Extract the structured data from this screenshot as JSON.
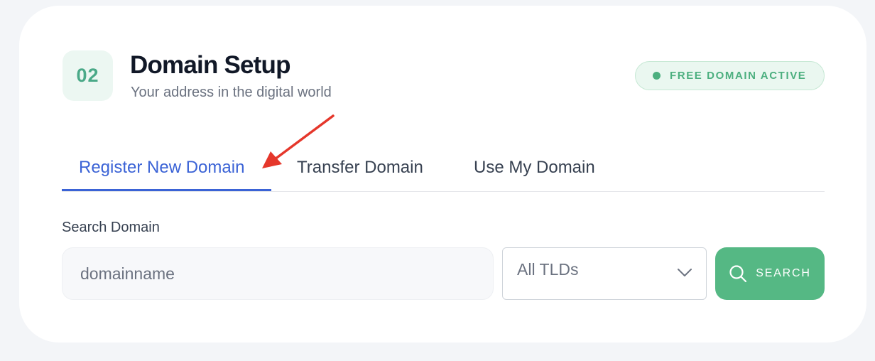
{
  "step": {
    "number": "02"
  },
  "header": {
    "title": "Domain Setup",
    "subtitle": "Your address in the digital world",
    "status_badge": "FREE DOMAIN ACTIVE"
  },
  "tabs": [
    {
      "label": "Register New Domain",
      "active": true
    },
    {
      "label": "Transfer Domain",
      "active": false
    },
    {
      "label": "Use My Domain",
      "active": false
    }
  ],
  "search": {
    "label": "Search Domain",
    "placeholder": "domainname",
    "value": "",
    "tld_selected": "All TLDs",
    "button_label": "SEARCH"
  },
  "annotation": {
    "arrow_color": "#e5372b"
  },
  "colors": {
    "accent_blue": "#3b63d6",
    "brand_green": "#55b884",
    "status_green": "#4caf7f",
    "badge_bg": "#ecf7f2"
  },
  "icons": {
    "status": "status-dot-icon",
    "chevron": "chevron-down-icon",
    "search": "search-icon",
    "annotation": "red-arrow-icon"
  }
}
